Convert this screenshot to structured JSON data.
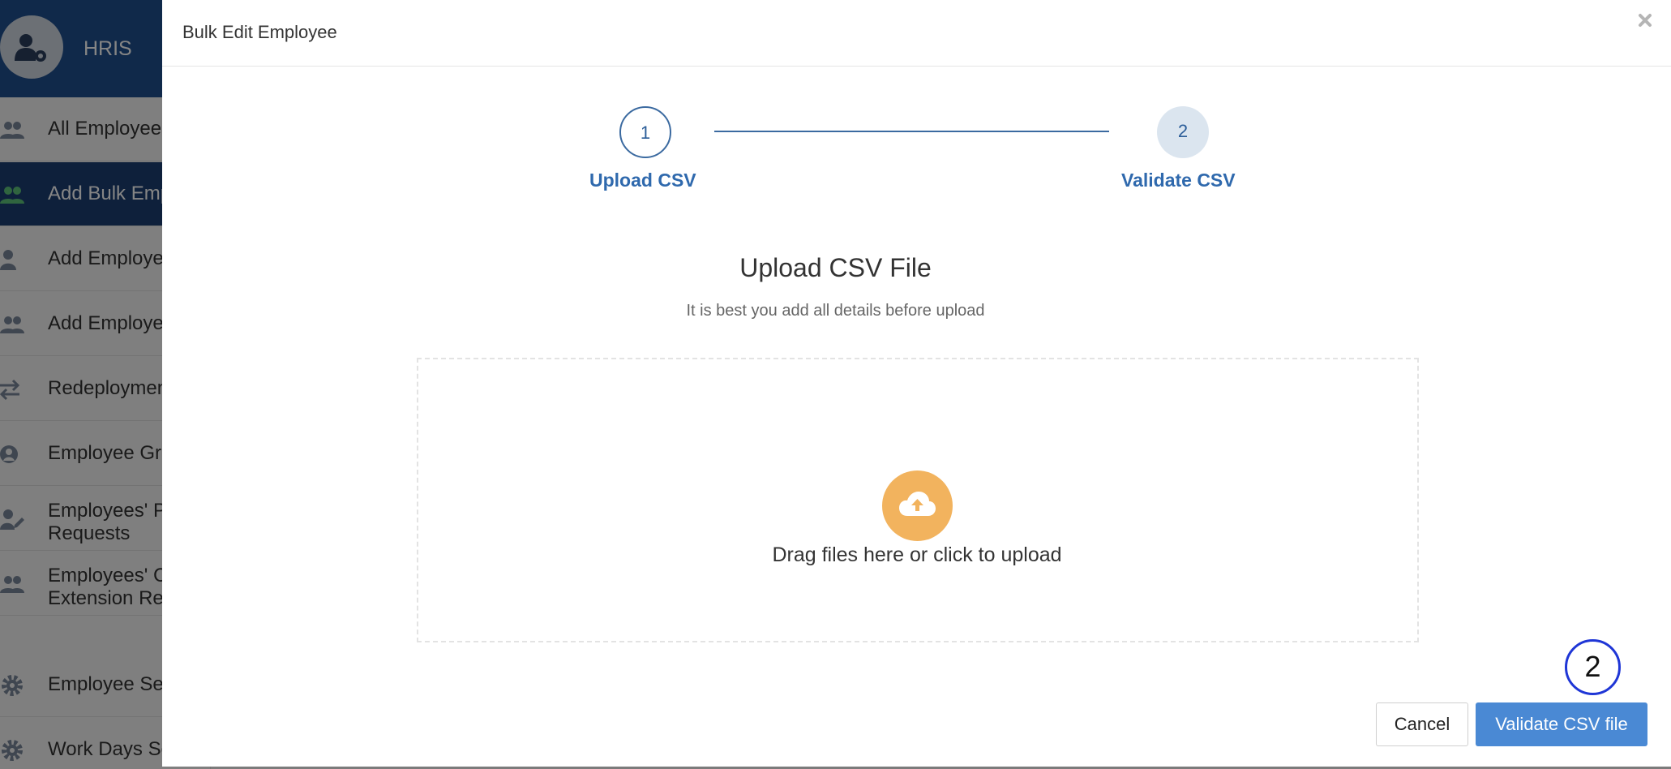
{
  "sidebar": {
    "title": "HRIS",
    "items": [
      {
        "label": "All Employees",
        "icon": "users-icon"
      },
      {
        "label": "Add Bulk Employees",
        "icon": "users-icon"
      },
      {
        "label": "Add Employee",
        "icon": "user-icon"
      },
      {
        "label": "Add Employees",
        "icon": "users-icon"
      },
      {
        "label": "Redeployment",
        "icon": "exchange-icon"
      },
      {
        "label": "Employee Groups",
        "icon": "user-circle-icon"
      },
      {
        "label_line1": "Employees' Profile",
        "label_line2": "Requests",
        "icon": "user-edit-icon"
      },
      {
        "label_line1": "Employees' Contract",
        "label_line2": "Extension Requests",
        "icon": "users-icon"
      },
      {
        "label": "Employee Settings",
        "icon": "gear-icon"
      },
      {
        "label": "Work Days Settings",
        "icon": "gear-icon"
      }
    ]
  },
  "modal": {
    "title": "Bulk Edit Employee",
    "steps": [
      {
        "number": "1",
        "label": "Upload CSV"
      },
      {
        "number": "2",
        "label": "Validate CSV"
      }
    ],
    "heading": "Upload CSV File",
    "subheading": "It is best you add all details before upload",
    "dropzone_text": "Drag files here or click to upload",
    "cancel_label": "Cancel",
    "validate_label": "Validate CSV file"
  },
  "annotation": {
    "marker": "2"
  },
  "colors": {
    "primary": "#4a89d4",
    "step_blue": "#2f69ad",
    "upload_orange": "#f2b35e",
    "sidebar_header": "#1f4f8f",
    "annotation_ring": "#1f36d6"
  }
}
